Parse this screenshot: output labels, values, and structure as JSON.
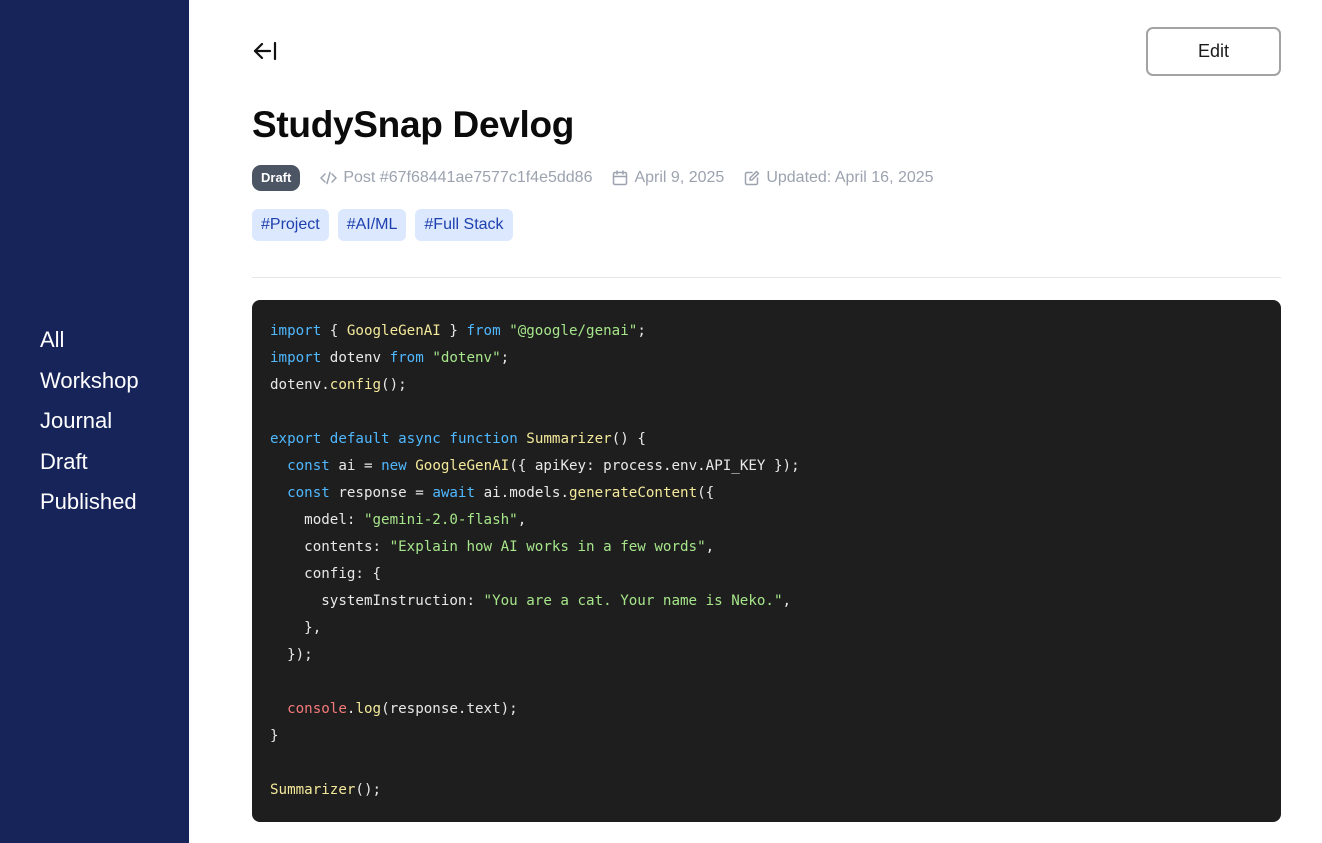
{
  "sidebar": {
    "items": [
      {
        "label": "All"
      },
      {
        "label": "Workshop"
      },
      {
        "label": "Journal"
      },
      {
        "label": "Draft"
      },
      {
        "label": "Published"
      }
    ]
  },
  "header": {
    "back_icon": "arrow-left-to-line-icon",
    "edit_label": "Edit"
  },
  "post": {
    "title": "StudySnap Devlog",
    "status": "Draft",
    "id_text": "Post #67f68441ae7577c1f4e5dd86",
    "created": "April 9, 2025",
    "updated": "Updated: April 16, 2025",
    "tags": [
      "#Project",
      "#AI/ML",
      "#Full Stack"
    ]
  },
  "code": {
    "language": "javascript",
    "lines": [
      [
        [
          "kw",
          "import"
        ],
        [
          "p",
          " { "
        ],
        [
          "fn",
          "GoogleGenAI"
        ],
        [
          "p",
          " } "
        ],
        [
          "kw",
          "from"
        ],
        [
          "p",
          " "
        ],
        [
          "str",
          "\"@google/genai\""
        ],
        [
          "p",
          ";"
        ]
      ],
      [
        [
          "kw",
          "import"
        ],
        [
          "p",
          " dotenv "
        ],
        [
          "kw",
          "from"
        ],
        [
          "p",
          " "
        ],
        [
          "str",
          "\"dotenv\""
        ],
        [
          "p",
          ";"
        ]
      ],
      [
        [
          "p",
          "dotenv."
        ],
        [
          "fn",
          "config"
        ],
        [
          "p",
          "();"
        ]
      ],
      [],
      [
        [
          "kw",
          "export"
        ],
        [
          "p",
          " "
        ],
        [
          "kw",
          "default"
        ],
        [
          "p",
          " "
        ],
        [
          "kw",
          "async"
        ],
        [
          "p",
          " "
        ],
        [
          "kw",
          "function"
        ],
        [
          "p",
          " "
        ],
        [
          "fn",
          "Summarizer"
        ],
        [
          "p",
          "() {"
        ]
      ],
      [
        [
          "p",
          "  "
        ],
        [
          "kw",
          "const"
        ],
        [
          "p",
          " ai = "
        ],
        [
          "kw",
          "new"
        ],
        [
          "p",
          " "
        ],
        [
          "fn",
          "GoogleGenAI"
        ],
        [
          "p",
          "({ apiKey: process.env.API_KEY });"
        ]
      ],
      [
        [
          "p",
          "  "
        ],
        [
          "kw",
          "const"
        ],
        [
          "p",
          " response = "
        ],
        [
          "kw",
          "await"
        ],
        [
          "p",
          " ai.models."
        ],
        [
          "fn",
          "generateContent"
        ],
        [
          "p",
          "({"
        ]
      ],
      [
        [
          "p",
          "    model: "
        ],
        [
          "str",
          "\"gemini-2.0-flash\""
        ],
        [
          "p",
          ","
        ]
      ],
      [
        [
          "p",
          "    contents: "
        ],
        [
          "str",
          "\"Explain how AI works in a few words\""
        ],
        [
          "p",
          ","
        ]
      ],
      [
        [
          "p",
          "    config: {"
        ]
      ],
      [
        [
          "p",
          "      systemInstruction: "
        ],
        [
          "str",
          "\"You are a cat. Your name is Neko.\""
        ],
        [
          "p",
          ","
        ]
      ],
      [
        [
          "p",
          "    },"
        ]
      ],
      [
        [
          "p",
          "  });"
        ]
      ],
      [],
      [
        [
          "p",
          "  "
        ],
        [
          "red",
          "console"
        ],
        [
          "p",
          "."
        ],
        [
          "fn",
          "log"
        ],
        [
          "p",
          "(response.text);"
        ]
      ],
      [
        [
          "p",
          "}"
        ]
      ],
      [],
      [
        [
          "fn",
          "Summarizer"
        ],
        [
          "p",
          "();"
        ]
      ]
    ]
  },
  "colors": {
    "sidebar_bg": "#17245a",
    "badge_bg": "#4b5563",
    "tag_bg": "#dbe8fe",
    "tag_text": "#1e40af",
    "code_bg": "#1e1e1e",
    "code_keyword": "#4fb8ff",
    "code_function": "#f4e99a",
    "code_string": "#a6e58a",
    "code_builtin": "#f47a7a"
  },
  "icons": {
    "post_id": "code-icon",
    "created": "calendar-icon",
    "updated": "edit-icon"
  }
}
